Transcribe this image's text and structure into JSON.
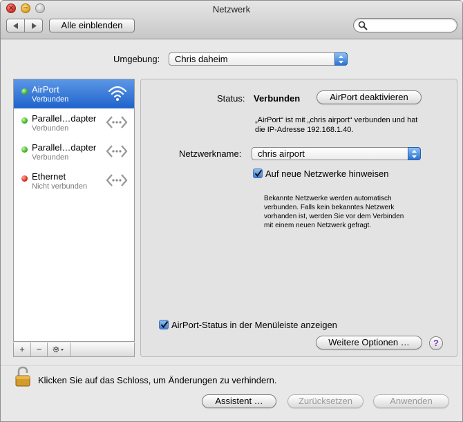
{
  "window": {
    "title": "Netzwerk",
    "close_glyph": "×",
    "minimize_glyph": "−",
    "zoom_glyph": ""
  },
  "toolbar": {
    "back_icon": "back-arrow-icon",
    "forward_icon": "forward-arrow-icon",
    "show_all_label": "Alle einblenden",
    "search_placeholder": ""
  },
  "location": {
    "label": "Umgebung:",
    "value": "Chris daheim"
  },
  "services": [
    {
      "name": "AirPort",
      "status": "Verbunden",
      "indicator": "green",
      "icon": "wifi-icon",
      "selected": true
    },
    {
      "name": "Parallel…dapter",
      "status": "Verbunden",
      "indicator": "green",
      "icon": "network-arrows-icon",
      "selected": false
    },
    {
      "name": "Parallel…dapter",
      "status": "Verbunden",
      "indicator": "green",
      "icon": "network-arrows-icon",
      "selected": false
    },
    {
      "name": "Ethernet",
      "status": "Nicht verbunden",
      "indicator": "red",
      "icon": "network-arrows-icon",
      "selected": false
    }
  ],
  "list_bar": {
    "add": "+",
    "remove": "−",
    "action_icon": "gear-icon"
  },
  "detail": {
    "status_label": "Status:",
    "status_value": "Verbunden",
    "toggle_button": "AirPort deaktivieren",
    "status_info_line1": "„AirPort“ ist mit „chris airport“ verbunden und hat",
    "status_info_line2": "die IP-Adresse 192.168.1.40.",
    "network_name_label": "Netzwerkname:",
    "network_name_value": "chris airport",
    "ask_new_networks_label": "Auf neue Netzwerke hinweisen",
    "ask_new_networks_checked": true,
    "ask_info_line1": "Bekannte Netzwerke werden automatisch",
    "ask_info_line2": "verbunden. Falls kein bekanntes Netzwerk",
    "ask_info_line3": "vorhanden ist, werden Sie vor dem Verbinden",
    "ask_info_line4": "mit einem neuen Netzwerk gefragt.",
    "menubar_status_label": "AirPort-Status in der Menüleiste anzeigen",
    "menubar_status_checked": true,
    "advanced_button": "Weitere Optionen …",
    "help_glyph": "?"
  },
  "footer": {
    "lock_text": "Klicken Sie auf das Schloss, um Änderungen zu verhindern.",
    "assistant_button": "Assistent …",
    "revert_button": "Zurücksetzen",
    "apply_button": "Anwenden"
  },
  "colors": {
    "selection": "#2a6bd1",
    "status_green": "#3fb524",
    "status_red": "#e3261a",
    "checkbox_blue": "#3a7fd9"
  }
}
